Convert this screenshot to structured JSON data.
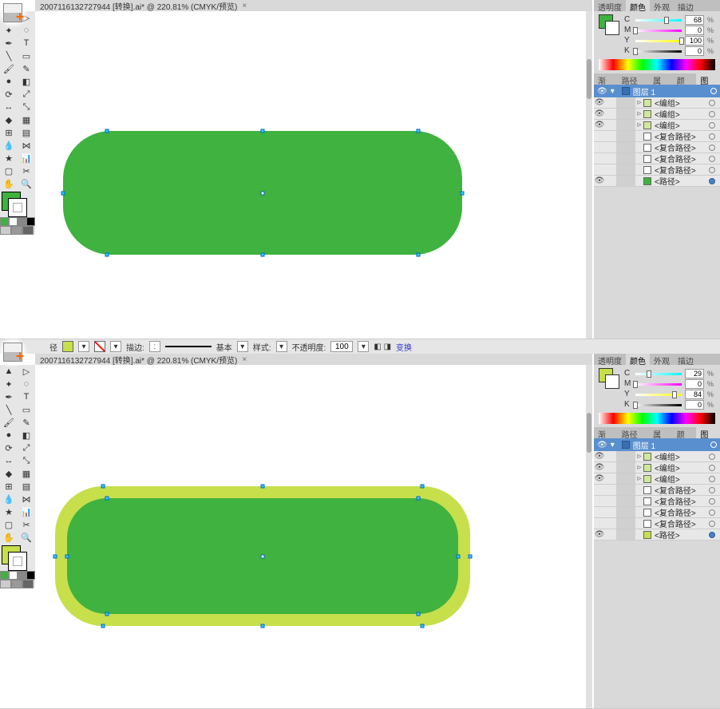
{
  "top": {
    "doc_tab": "2007116132727944  [转换].ai* @ 220.81% (CMYK/预览)",
    "color_panel_tabs": [
      "透明度",
      "颜色",
      "外观",
      "描边"
    ],
    "color_active_tab": "颜色",
    "fill_color": "#3fb23f",
    "channels": [
      {
        "name": "C",
        "val": "68",
        "pct": "%",
        "grad": "linear-gradient(90deg,#fff,#0ff)",
        "pos": 68
      },
      {
        "name": "M",
        "val": "0",
        "pct": "%",
        "grad": "linear-gradient(90deg,#fff,#f0f)",
        "pos": 0
      },
      {
        "name": "Y",
        "val": "100",
        "pct": "%",
        "grad": "linear-gradient(90deg,#fff,#ff0)",
        "pos": 100
      },
      {
        "name": "K",
        "val": "0",
        "pct": "%",
        "grad": "linear-gradient(90deg,#fff,#000)",
        "pos": 0
      }
    ],
    "layer_tabs": [
      "渐变",
      "路径控",
      "属性",
      "颜色",
      "图层"
    ],
    "layer_active_tab": "图层",
    "layer_name": "图层 1",
    "sublayers": [
      {
        "tw": "▹",
        "sw": "#cfe89a",
        "name": "<编组>",
        "eye": true,
        "ring": false
      },
      {
        "tw": "▹",
        "sw": "#cfe89a",
        "name": "<编组>",
        "eye": true,
        "ring": false
      },
      {
        "tw": "▹",
        "sw": "#cfe89a",
        "name": "<编组>",
        "eye": true,
        "ring": false
      },
      {
        "tw": "",
        "sw": "#ffffff",
        "name": "<复合路径>",
        "eye": false,
        "ring": false
      },
      {
        "tw": "",
        "sw": "#ffffff",
        "name": "<复合路径>",
        "eye": false,
        "ring": false
      },
      {
        "tw": "",
        "sw": "#ffffff",
        "name": "<复合路径>",
        "eye": false,
        "ring": false
      },
      {
        "tw": "",
        "sw": "#ffffff",
        "name": "<复合路径>",
        "eye": false,
        "ring": false
      },
      {
        "tw": "",
        "sw": "#3fb23f",
        "name": "<路径>",
        "eye": true,
        "ring": true
      }
    ]
  },
  "bottom": {
    "doc_tab": "2007116132727944  [转换].ai* @ 220.81% (CMYK/预览)",
    "optbar": {
      "fill": "#c7df4b",
      "stroke_label": "描边:",
      "basic_label": "基本",
      "style_label": "样式:",
      "opacity_label": "不透明度:",
      "opacity_val": "100",
      "convert_label": "变换"
    },
    "color_panel_tabs": [
      "透明度",
      "颜色",
      "外观",
      "描边"
    ],
    "color_active_tab": "颜色",
    "fill_color": "#c7df4b",
    "channels": [
      {
        "name": "C",
        "val": "29",
        "pct": "%",
        "grad": "linear-gradient(90deg,#fff,#0ff)",
        "pos": 29
      },
      {
        "name": "M",
        "val": "0",
        "pct": "%",
        "grad": "linear-gradient(90deg,#fff,#f0f)",
        "pos": 0
      },
      {
        "name": "Y",
        "val": "84",
        "pct": "%",
        "grad": "linear-gradient(90deg,#fff,#ff0)",
        "pos": 84
      },
      {
        "name": "K",
        "val": "0",
        "pct": "%",
        "grad": "linear-gradient(90deg,#fff,#000)",
        "pos": 0
      }
    ],
    "layer_tabs": [
      "渐变",
      "路径控",
      "属性",
      "颜色",
      "图层"
    ],
    "layer_active_tab": "图层",
    "layer_name": "图层 1",
    "sublayers": [
      {
        "tw": "▹",
        "sw": "#cfe89a",
        "name": "<编组>",
        "eye": true,
        "ring": false
      },
      {
        "tw": "▹",
        "sw": "#cfe89a",
        "name": "<编组>",
        "eye": true,
        "ring": false
      },
      {
        "tw": "▹",
        "sw": "#cfe89a",
        "name": "<编组>",
        "eye": true,
        "ring": false
      },
      {
        "tw": "",
        "sw": "#ffffff",
        "name": "<复合路径>",
        "eye": false,
        "ring": false
      },
      {
        "tw": "",
        "sw": "#ffffff",
        "name": "<复合路径>",
        "eye": false,
        "ring": false
      },
      {
        "tw": "",
        "sw": "#ffffff",
        "name": "<复合路径>",
        "eye": false,
        "ring": false
      },
      {
        "tw": "",
        "sw": "#ffffff",
        "name": "<复合路径>",
        "eye": false,
        "ring": false
      },
      {
        "tw": "",
        "sw": "#c7df4b",
        "name": "<路径>",
        "eye": true,
        "ring": true
      }
    ]
  },
  "tools": [
    "selection",
    "direct-select",
    "magic-wand",
    "lasso",
    "pen",
    "type",
    "line",
    "rectangle",
    "brush",
    "pencil",
    "blob",
    "eraser",
    "rotate",
    "scale",
    "width",
    "free-transform",
    "shape-builder",
    "perspective",
    "mesh",
    "gradient",
    "eyedrop",
    "blend",
    "symbol",
    "graph",
    "artboard",
    "slice",
    "hand",
    "zoom"
  ]
}
